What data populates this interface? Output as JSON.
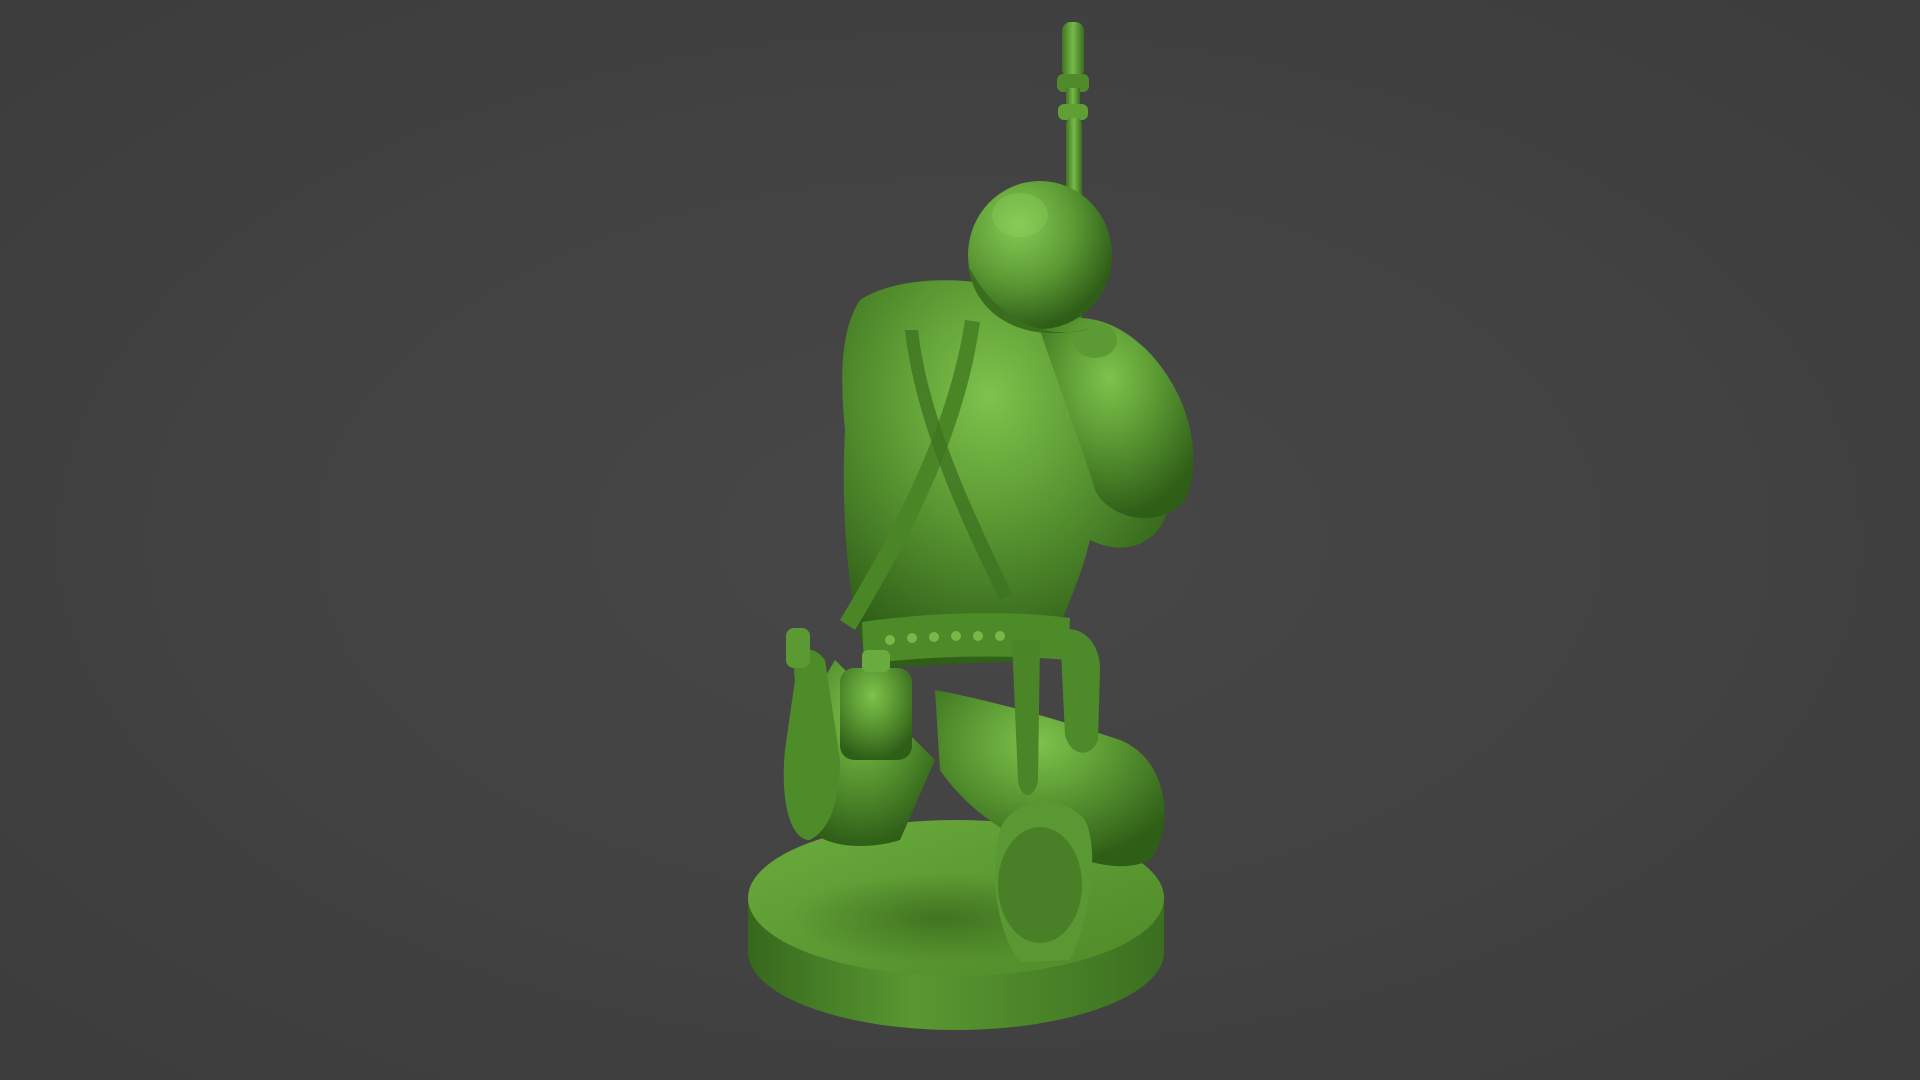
{
  "scene": {
    "background_color": "#424242",
    "model_color": "#4f8a2a",
    "model_highlight": "#7bbf4a",
    "model_shadow": "#2f5c16",
    "model_description_icon": "kneeling-soldier-figurine-icon"
  }
}
